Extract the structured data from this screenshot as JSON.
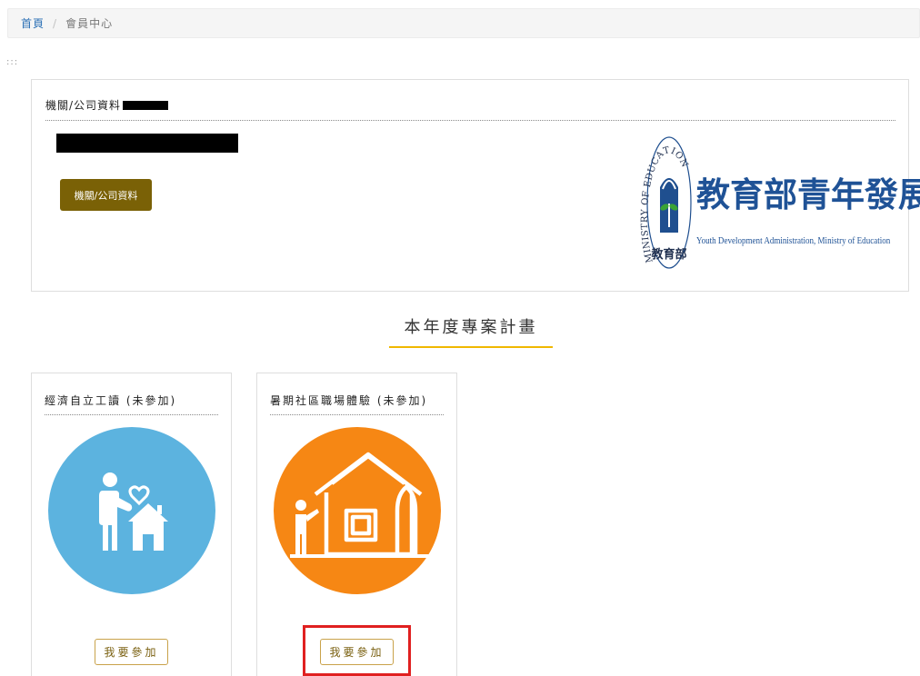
{
  "breadcrumb": {
    "home": "首頁",
    "separator": "/",
    "current": "會員中心"
  },
  "accesskey": ":::",
  "org_panel": {
    "heading": "機關/公司資料",
    "button_label": "機關/公司資料",
    "logo": {
      "title": "教育部青年發展署",
      "subtitle": "Youth Development Administration, Ministry of Education",
      "seal_text": "MINISTRY OF EDUCATION",
      "seal_bottom": "教育部"
    }
  },
  "section": {
    "title": "本年度專案計畫"
  },
  "cards": [
    {
      "title": "經濟自立工讀 (未參加)",
      "button_label": "我要參加",
      "color": "#5cb3df",
      "icon": "person-house-heart-icon"
    },
    {
      "title": "暑期社區職場體驗 (未參加)",
      "button_label": "我要參加",
      "color": "#f68714",
      "icon": "person-building-tree-icon"
    }
  ],
  "colors": {
    "accent": "#f0b800",
    "org_button": "#7a6106",
    "link": "#2a6fb5",
    "highlight": "#e02020"
  }
}
